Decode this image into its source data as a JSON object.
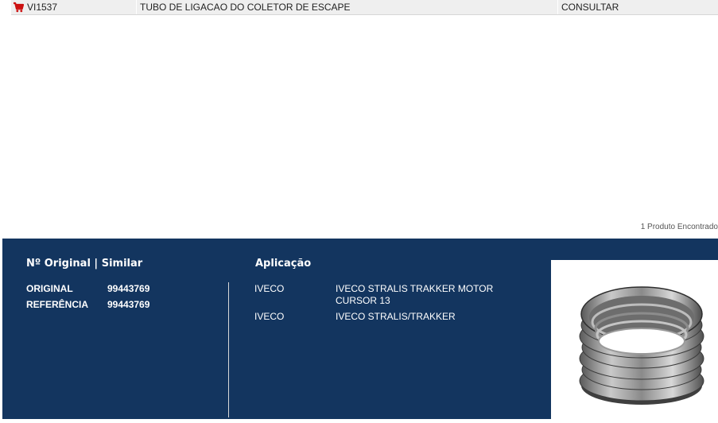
{
  "result_row": {
    "code": "VI1537",
    "description": "TUBO DE LIGACAO DO COLETOR DE ESCAPE",
    "price": "CONSULTAR",
    "cart_icon": "shopping-cart-icon"
  },
  "results_count": "1 Produto Encontrado",
  "detail": {
    "numbers_title": "Nº Original | Similar",
    "original_label": "ORIGINAL",
    "original_value": "99443769",
    "reference_label": "REFERÊNCIA",
    "reference_value": "99443769",
    "application_title": "Aplicação",
    "applications": [
      {
        "brand": "IVECO",
        "model": "IVECO STRALIS TRAKKER MOTOR CURSOR 13"
      },
      {
        "brand": "IVECO",
        "model": "IVECO STRALIS/TRAKKER"
      }
    ]
  },
  "colors": {
    "panel_bg": "#13355f",
    "row_bg": "#efefef",
    "cart": "#cc1111"
  }
}
